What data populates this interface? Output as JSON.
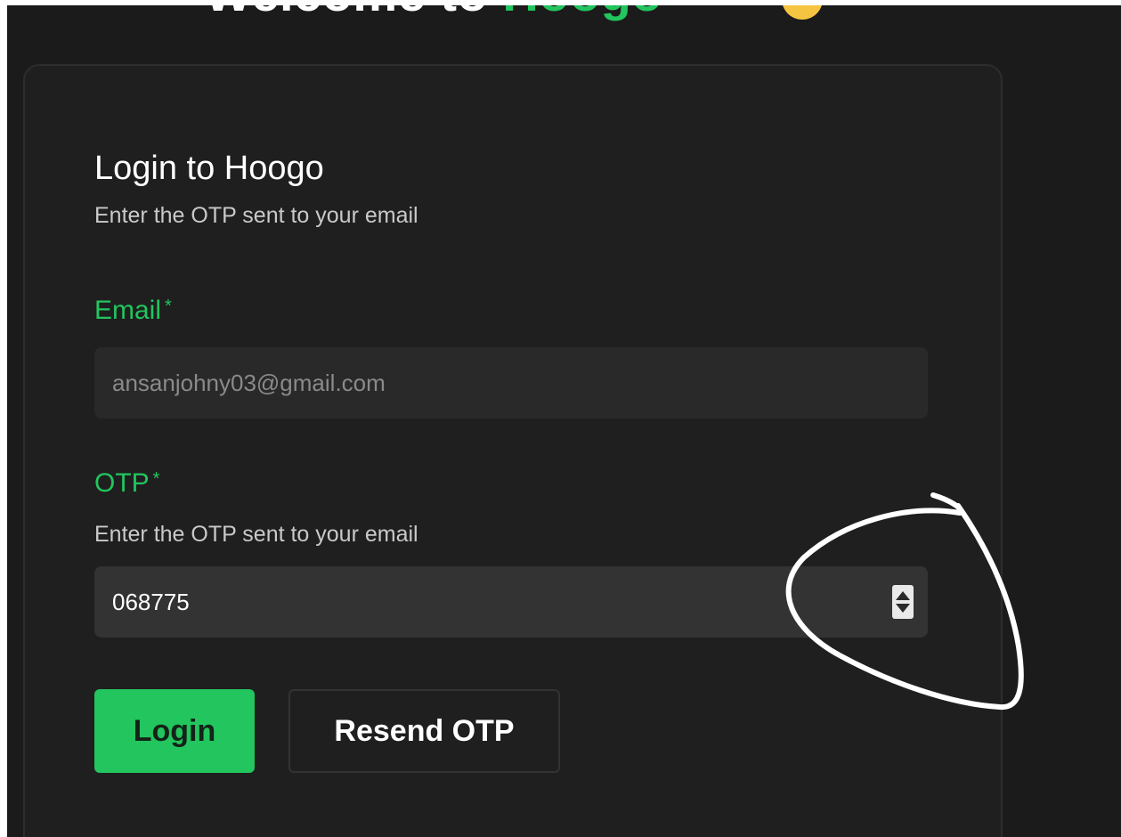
{
  "header": {
    "welcome_prefix": "Welcome to ",
    "brand": "Hoogo"
  },
  "card": {
    "title": "Login to Hoogo",
    "subtitle": "Enter the OTP sent to your email"
  },
  "email_field": {
    "label": "Email",
    "required_mark": "*",
    "value": "ansanjohny03@gmail.com"
  },
  "otp_field": {
    "label": "OTP",
    "required_mark": "*",
    "help": "Enter the OTP sent to your email",
    "value": "068775"
  },
  "actions": {
    "login_label": "Login",
    "resend_label": "Resend OTP"
  },
  "colors": {
    "accent": "#22c55e",
    "background": "#1b1b1b",
    "card": "#1f1f1f"
  },
  "icons": {
    "number_spinner": "up-down-spinner-icon",
    "header_emoji": "waving-hand-icon"
  }
}
